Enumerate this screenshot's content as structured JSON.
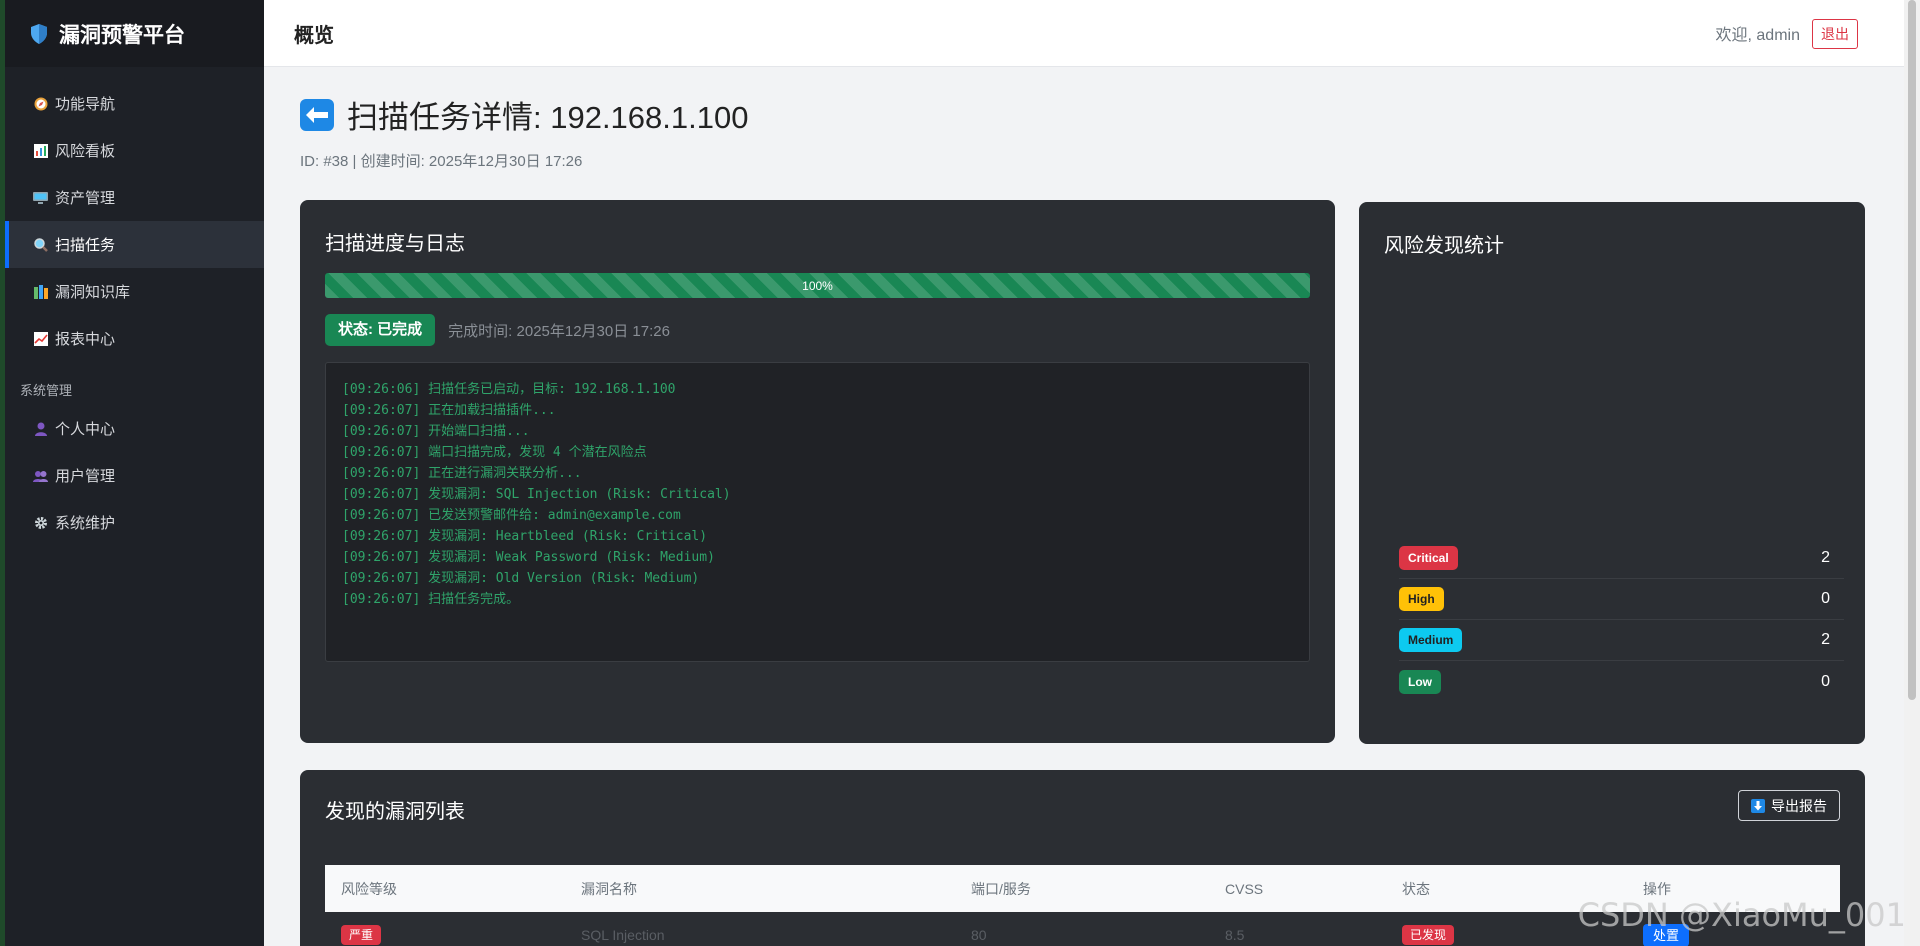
{
  "app": {
    "brand": "漏洞预警平台"
  },
  "sidebar": {
    "items": [
      {
        "label": "功能导航",
        "icon": "compass-icon"
      },
      {
        "label": "风险看板",
        "icon": "bar-chart-icon"
      },
      {
        "label": "资产管理",
        "icon": "monitor-icon"
      },
      {
        "label": "扫描任务",
        "icon": "magnifier-icon",
        "active": true
      },
      {
        "label": "漏洞知识库",
        "icon": "books-icon"
      },
      {
        "label": "报表中心",
        "icon": "line-chart-icon"
      }
    ],
    "section_label": "系统管理",
    "admin_items": [
      {
        "label": "个人中心",
        "icon": "user-icon"
      },
      {
        "label": "用户管理",
        "icon": "users-icon"
      },
      {
        "label": "系统维护",
        "icon": "gear-icon"
      }
    ]
  },
  "topbar": {
    "title": "概览",
    "welcome": "欢迎, admin",
    "logout": "退出"
  },
  "page": {
    "title": "扫描任务详情: 192.168.1.100",
    "meta": "ID: #38 | 创建时间: 2025年12月30日 17:26"
  },
  "progress_card": {
    "title": "扫描进度与日志",
    "progress": 100,
    "progress_text": "100%",
    "status": "状态: 已完成",
    "finish_time": "完成时间: 2025年12月30日 17:26",
    "log": [
      "[09:26:06] 扫描任务已启动，目标: 192.168.1.100",
      "[09:26:07] 正在加载扫描插件...",
      "[09:26:07] 开始端口扫描...",
      "[09:26:07] 端口扫描完成，发现 4 个潜在风险点",
      "[09:26:07] 正在进行漏洞关联分析...",
      "[09:26:07] 发现漏洞: SQL Injection (Risk: Critical)",
      "[09:26:07] 已发送预警邮件给: admin@example.com",
      "[09:26:07] 发现漏洞: Heartbleed (Risk: Critical)",
      "[09:26:07] 发现漏洞: Weak Password (Risk: Medium)",
      "[09:26:07] 发现漏洞: Old Version (Risk: Medium)",
      "[09:26:07] 扫描任务完成。"
    ]
  },
  "stats_card": {
    "title": "风险发现统计",
    "rows": [
      {
        "label": "Critical",
        "count": "2",
        "bg": "#dc3545",
        "fg": "#ffffff"
      },
      {
        "label": "High",
        "count": "0",
        "bg": "#ffc107",
        "fg": "#222222"
      },
      {
        "label": "Medium",
        "count": "2",
        "bg": "#0dcaf0",
        "fg": "#222222"
      },
      {
        "label": "Low",
        "count": "0",
        "bg": "#198754",
        "fg": "#ffffff"
      }
    ]
  },
  "vuln_card": {
    "title": "发现的漏洞列表",
    "export": "导出报告",
    "columns": [
      "风险等级",
      "漏洞名称",
      "端口/服务",
      "CVSS",
      "状态",
      "操作"
    ],
    "rows": [
      {
        "level": "严重",
        "name": "SQL Injection",
        "port": "80",
        "cvss": "8.5",
        "status": "已发现",
        "action": "处置"
      }
    ]
  },
  "watermark": "CSDN @XiaoMu_001"
}
